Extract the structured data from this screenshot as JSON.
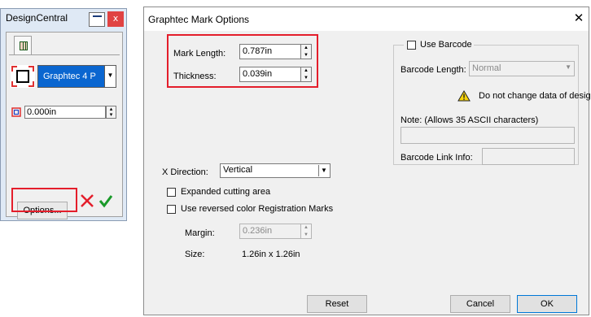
{
  "design_central": {
    "title": "DesignCentral",
    "close_glyph": "x",
    "combo_value": "Graphtec 4 P",
    "offset_value": "0.000in",
    "options_label": "Options...",
    "icons": [
      "table-icon",
      "registration-mark-icon",
      "offset-icon",
      "cancel-x-icon",
      "apply-check-icon"
    ]
  },
  "dialog": {
    "title": "Graphtec Mark Options",
    "close_glyph": "✕",
    "mark_length": {
      "label": "Mark Length:",
      "value": "0.787in"
    },
    "thickness": {
      "label": "Thickness:",
      "value": "0.039in"
    },
    "barcode": {
      "checkbox_label": "Use Barcode",
      "length_label": "Barcode Length:",
      "length_value": "Normal",
      "warning": "Do not change data of design",
      "note_label": "Note: (Allows 35 ASCII characters)",
      "note_value": "",
      "link_label": "Barcode Link Info:",
      "link_value": ""
    },
    "x_direction": {
      "label": "X Direction:",
      "value": "Vertical"
    },
    "expanded_label": "Expanded cutting area",
    "reversed_label": "Use reversed color Registration Marks",
    "margin": {
      "label": "Margin:",
      "value": "0.236in"
    },
    "size": {
      "label": "Size:",
      "value": "1.26in x 1.26in"
    },
    "buttons": {
      "reset": "Reset",
      "cancel": "Cancel",
      "ok": "OK"
    }
  },
  "colors": {
    "highlight": "#e41e2b",
    "selection": "#0a66d0",
    "panel_bg": "#dfe9f5",
    "dialog_bg": "#f0f0f0"
  }
}
